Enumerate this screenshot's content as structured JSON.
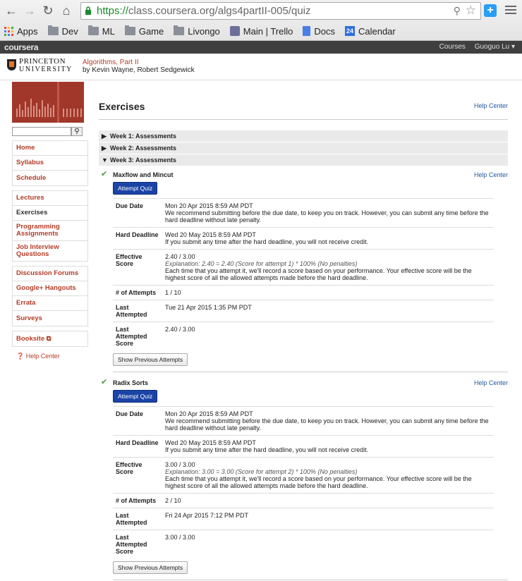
{
  "browser": {
    "url_scheme": "https://",
    "url_rest": "class.coursera.org/algs4partII-005/quiz",
    "bookmarks": [
      "Apps",
      "Dev",
      "ML",
      "Game",
      "Livongo",
      "Main | Trello",
      "Docs",
      "Calendar"
    ],
    "calendar_day": "24",
    "ext_label": "+"
  },
  "topbar": {
    "logo": "coursera",
    "courses": "Courses",
    "user": "Guoguo Lu ▾"
  },
  "course": {
    "uni_line1": "PRINCETON",
    "uni_line2": "UNIVERSITY",
    "name": "Algorithms, Part II",
    "authors": "by Kevin Wayne, Robert Sedgewick"
  },
  "sidebar": {
    "groups": [
      [
        "Home",
        "Syllabus",
        "Schedule"
      ],
      [
        "Lectures",
        "Exercises",
        "Programming Assignments",
        "Job Interview Questions"
      ],
      [
        "Discussion Forums",
        "Google+ Hangouts",
        "Errata",
        "Surveys"
      ],
      [
        "Booksite ⧉"
      ]
    ],
    "active": "Exercises",
    "help": "Help Center"
  },
  "main": {
    "title": "Exercises",
    "help": "Help Center",
    "weeks": [
      "Week 1: Assessments",
      "Week 2: Assessments",
      "Week 3: Assessments"
    ]
  },
  "quizzes": [
    {
      "name": "Maxflow and Mincut",
      "help": "Help Center",
      "attempt": "Attempt Quiz",
      "rows": [
        [
          "Due Date",
          "Mon 20 Apr 2015 8:59 AM PDT",
          "We recommend submitting before the due date, to keep you on track. However, you can submit any time before the hard deadline without late penalty."
        ],
        [
          "Hard Deadline",
          "Wed 20 May 2015 8:59 AM PDT",
          "If you submit any time after the hard deadline, you will not receive credit."
        ],
        [
          "Effective Score",
          "2.40 / 3.00",
          "Explanation: 2.40 = 2.40 (Score for attempt 1) * 100% (No penalties)",
          "Each time that you attempt it, we'll record a score based on your performance. Your effective score will be the highest score of all the allowed attempts made before the hard deadline."
        ],
        [
          "# of Attempts",
          "1 / 10"
        ],
        [
          "Last Attempted",
          "Tue 21 Apr 2015 1:35 PM PDT"
        ],
        [
          "Last Attempted Score",
          "2.40 / 3.00"
        ]
      ],
      "prev": "Show Previous Attempts"
    },
    {
      "name": "Radix Sorts",
      "help": "Help Center",
      "attempt": "Attempt Quiz",
      "rows": [
        [
          "Due Date",
          "Mon 20 Apr 2015 8:59 AM PDT",
          "We recommend submitting before the due date, to keep you on track. However, you can submit any time before the hard deadline without late penalty."
        ],
        [
          "Hard Deadline",
          "Wed 20 May 2015 8:59 AM PDT",
          "If you submit any time after the hard deadline, you will not receive credit."
        ],
        [
          "Effective Score",
          "3.00 / 3.00",
          "Explanation: 3.00 = 3.00 (Score for attempt 2) * 100% (No penalties)",
          "Each time that you attempt it, we'll record a score based on your performance. Your effective score will be the highest score of all the allowed attempts made before the hard deadline."
        ],
        [
          "# of Attempts",
          "2 / 10"
        ],
        [
          "Last Attempted",
          "Fri 24 Apr 2015 7:12 PM PDT"
        ],
        [
          "Last Attempted Score",
          "3.00 / 3.00"
        ]
      ],
      "prev": "Show Previous Attempts"
    }
  ]
}
